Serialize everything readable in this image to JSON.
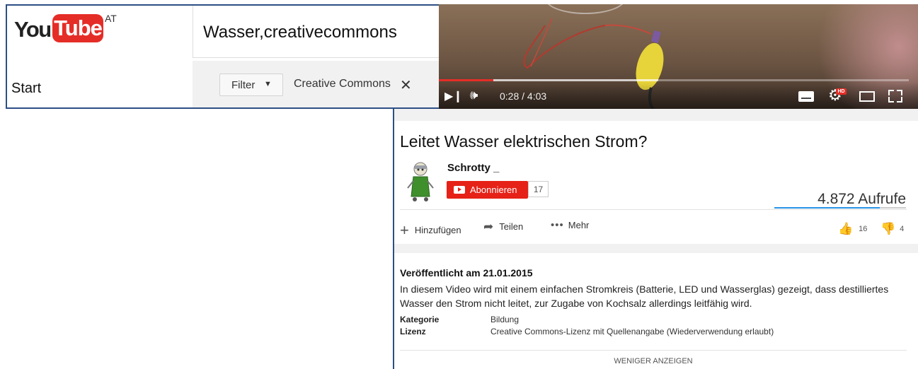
{
  "search_panel": {
    "logo": {
      "you": "You",
      "tube": "Tube",
      "country": "AT"
    },
    "search_query": "Wasser,creativecommons",
    "sidebar_item": "Start",
    "filter_label": "Filter",
    "active_filter_chip": "Creative Commons"
  },
  "player": {
    "time": "0:28 / 4:03",
    "progress_fraction": 0.116,
    "hd_badge": "HD"
  },
  "video": {
    "title": "Leitet Wasser elektrischen Strom?",
    "channel_name": "Schrotty _",
    "subscribe_label": "Abonnieren",
    "subscriber_count": "17",
    "view_count": "4.872 Aufrufe",
    "actions": {
      "add": "Hinzufügen",
      "share": "Teilen",
      "more": "Mehr"
    },
    "likes": "16",
    "dislikes": "4"
  },
  "description": {
    "published": "Veröffentlicht am 21.01.2015",
    "text": "In diesem Video wird mit einem einfachen Stromkreis (Batterie, LED und Wasserglas) gezeigt, dass destilliertes Wasser den Strom nicht leitet, zur Zugabe von Kochsalz allerdings leitfähig wird.",
    "category_key": "Kategorie",
    "category_value": "Bildung",
    "license_key": "Lizenz",
    "license_value": "Creative Commons-Lizenz mit Quellenangabe (Wiederverwendung erlaubt)",
    "show_less": "WENIGER ANZEIGEN"
  },
  "colors": {
    "brand_red": "#e52d27",
    "frame_blue": "#2d4e84",
    "sentiment_blue": "#2793e6"
  }
}
